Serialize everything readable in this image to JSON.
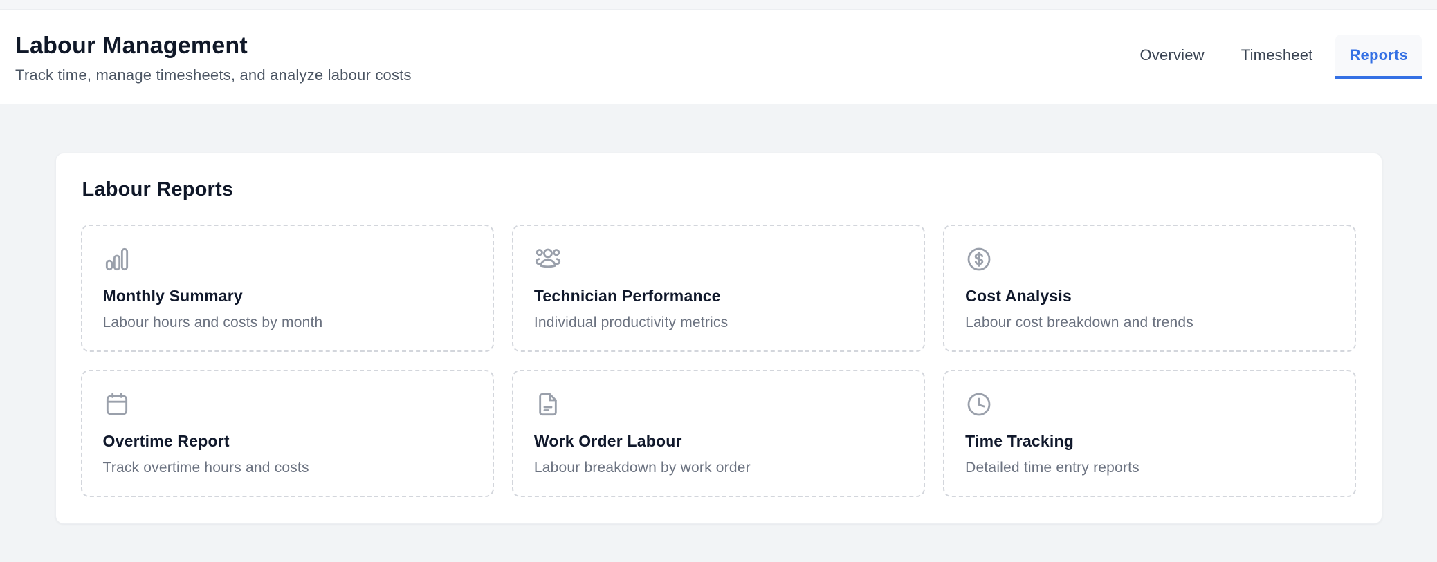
{
  "header": {
    "title": "Labour Management",
    "subtitle": "Track time, manage timesheets, and analyze labour costs",
    "tabs": [
      {
        "label": "Overview",
        "active": false
      },
      {
        "label": "Timesheet",
        "active": false
      },
      {
        "label": "Reports",
        "active": true
      }
    ]
  },
  "panel": {
    "title": "Labour Reports",
    "reports": [
      {
        "icon": "bar-chart-icon",
        "title": "Monthly Summary",
        "description": "Labour hours and costs by month"
      },
      {
        "icon": "users-icon",
        "title": "Technician Performance",
        "description": "Individual productivity metrics"
      },
      {
        "icon": "dollar-circle-icon",
        "title": "Cost Analysis",
        "description": "Labour cost breakdown and trends"
      },
      {
        "icon": "calendar-icon",
        "title": "Overtime Report",
        "description": "Track overtime hours and costs"
      },
      {
        "icon": "file-text-icon",
        "title": "Work Order Labour",
        "description": "Labour breakdown by work order"
      },
      {
        "icon": "clock-icon",
        "title": "Time Tracking",
        "description": "Detailed time entry reports"
      }
    ]
  },
  "colors": {
    "accent": "#3470e4",
    "icon_gray": "#9aa0ab",
    "heading": "#101828",
    "muted_text": "#6b7280",
    "dashed_border": "#d3d6dc",
    "page_background": "#f2f4f6"
  }
}
